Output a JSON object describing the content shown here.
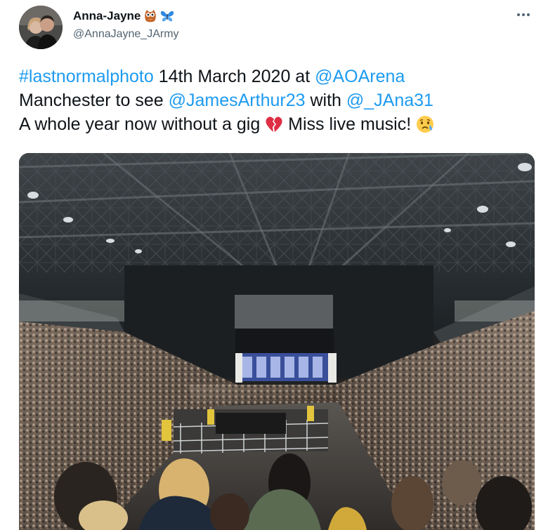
{
  "author": {
    "name": "Anna-Jayne",
    "handle": "@AnnaJayne_JArmy",
    "emojis": [
      "owl-emoji",
      "butterfly-emoji"
    ]
  },
  "tweet": {
    "hashtag": "#lastnormalphoto",
    "text_1": " 14th March 2020 at ",
    "mention_1": "@AOArena",
    "text_2": "Manchester to see ",
    "mention_2": "@JamesArthur23",
    "text_3": " with ",
    "mention_3": "@_JAna31",
    "text_4": "A whole year now without a gig ",
    "text_5": " Miss live music! "
  },
  "icons": {
    "more": "more-options-icon",
    "broken_heart": "broken-heart-emoji",
    "crying": "crying-face-emoji"
  },
  "colors": {
    "link": "#1d9bf0",
    "text": "#0f1419",
    "secondary": "#536471"
  }
}
